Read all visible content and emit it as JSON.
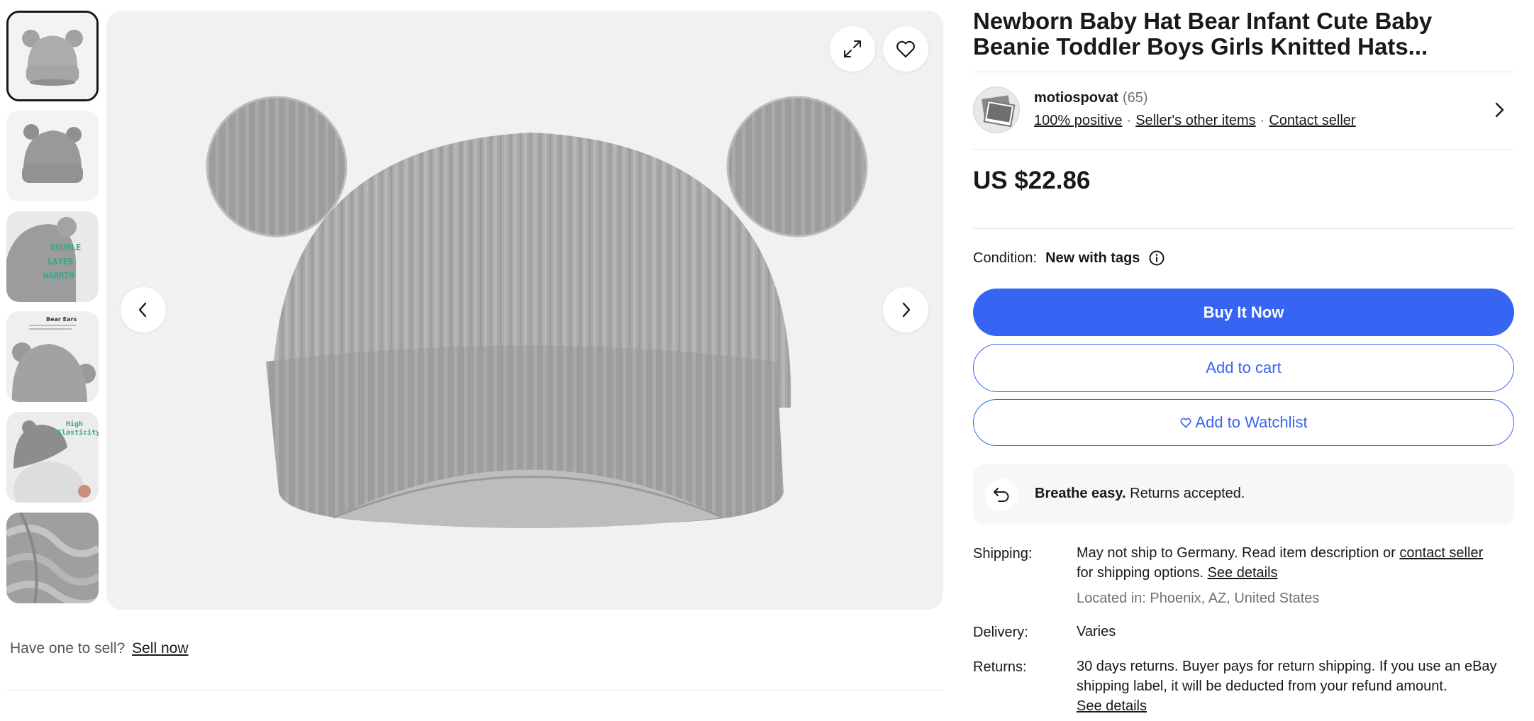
{
  "gallery": {
    "thumbnails": [
      {
        "name": "thumbnail-1",
        "caption": ""
      },
      {
        "name": "thumbnail-2",
        "caption": ""
      },
      {
        "name": "thumbnail-3",
        "caption": "DOUBLE LAYER WARMTH"
      },
      {
        "name": "thumbnail-4",
        "caption": "Bear Ears"
      },
      {
        "name": "thumbnail-5",
        "caption": "High Elasticity"
      },
      {
        "name": "thumbnail-6",
        "caption": ""
      }
    ],
    "active_index": 0,
    "icons": {
      "expand": "expand-icon",
      "favorite": "heart-icon",
      "prev": "chevron-left-icon",
      "next": "chevron-right-icon"
    }
  },
  "sell": {
    "prompt": "Have one to sell?",
    "link": "Sell now"
  },
  "listing": {
    "title": "Newborn Baby Hat Bear Infant Cute Baby Beanie Toddler Boys Girls Knitted Hats...",
    "price": "US $22.86"
  },
  "seller": {
    "name": "motiospovat",
    "feedback_count": "(65)",
    "positive": "100% positive",
    "other_items": "Seller's other items",
    "contact": "Contact seller",
    "separator": "·"
  },
  "condition": {
    "label": "Condition:",
    "value": "New with tags"
  },
  "actions": {
    "buy_now": "Buy It Now",
    "add_to_cart": "Add to cart",
    "add_to_watchlist": "Add to Watchlist"
  },
  "returns_banner": {
    "bold": "Breathe easy.",
    "text": " Returns accepted."
  },
  "shipping": {
    "label": "Shipping:",
    "line1": "May not ship to Germany. Read item description or ",
    "contact_link": "contact seller",
    "line2": "for shipping options. ",
    "see_details": "See details",
    "location": "Located in: Phoenix, AZ, United States"
  },
  "delivery": {
    "label": "Delivery:",
    "value": "Varies"
  },
  "returns": {
    "label": "Returns:",
    "value": "30 days returns. Buyer pays for return shipping. If you use an eBay shipping label, it will be deducted from your refund amount.",
    "see_details": "See details"
  },
  "colors": {
    "primary": "#3665f3",
    "text": "#191919",
    "muted": "#707070",
    "hat": "#a9a9a9"
  }
}
